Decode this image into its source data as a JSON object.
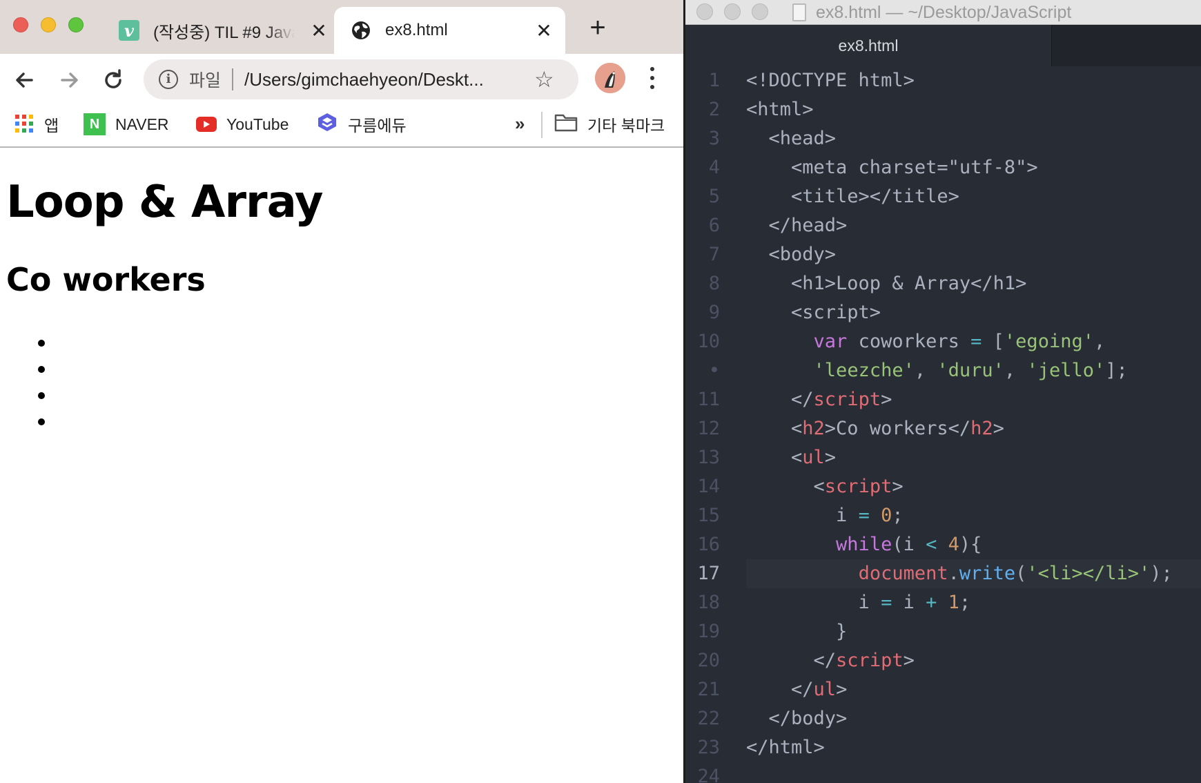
{
  "browser": {
    "tabs": [
      {
        "title": "(작성중) TIL #9 Java",
        "active": false
      },
      {
        "title": "ex8.html",
        "active": true
      }
    ],
    "new_tab": "+",
    "close_glyph": "✕",
    "address": {
      "scheme_label": "파일",
      "url": "/Users/gimchaehyeon/Deskt..."
    },
    "bookmarks": [
      {
        "label": "앱",
        "icon": "apps-grid-icon"
      },
      {
        "label": "NAVER",
        "icon": "naver-icon"
      },
      {
        "label": "YouTube",
        "icon": "youtube-icon"
      },
      {
        "label": "구름에듀",
        "icon": "goorm-icon"
      }
    ],
    "bookmarks_overflow": "»",
    "other_bookmarks": "기타 북마크",
    "page": {
      "h1": "Loop & Array",
      "h2": "Co workers",
      "list_item_count": 4
    },
    "colors": {
      "tabstrip": "#e1d9d6",
      "omnibox": "#eeeaea"
    }
  },
  "editor": {
    "window_title": "ex8.html — ~/Desktop/JavaScript",
    "tab_label": "ex8.html",
    "active_line": "17",
    "line_numbers": [
      "1",
      "2",
      "3",
      "4",
      "5",
      "6",
      "7",
      "8",
      "9",
      "10",
      "•",
      "11",
      "12",
      "13",
      "14",
      "15",
      "16",
      "17",
      "18",
      "19",
      "20",
      "21",
      "22",
      "23",
      "24"
    ],
    "colors": {
      "background": "#282c34",
      "keyword": "#c678dd",
      "string": "#98c379",
      "tag": "#e06c75",
      "number": "#d19a66",
      "function": "#61afef"
    }
  }
}
